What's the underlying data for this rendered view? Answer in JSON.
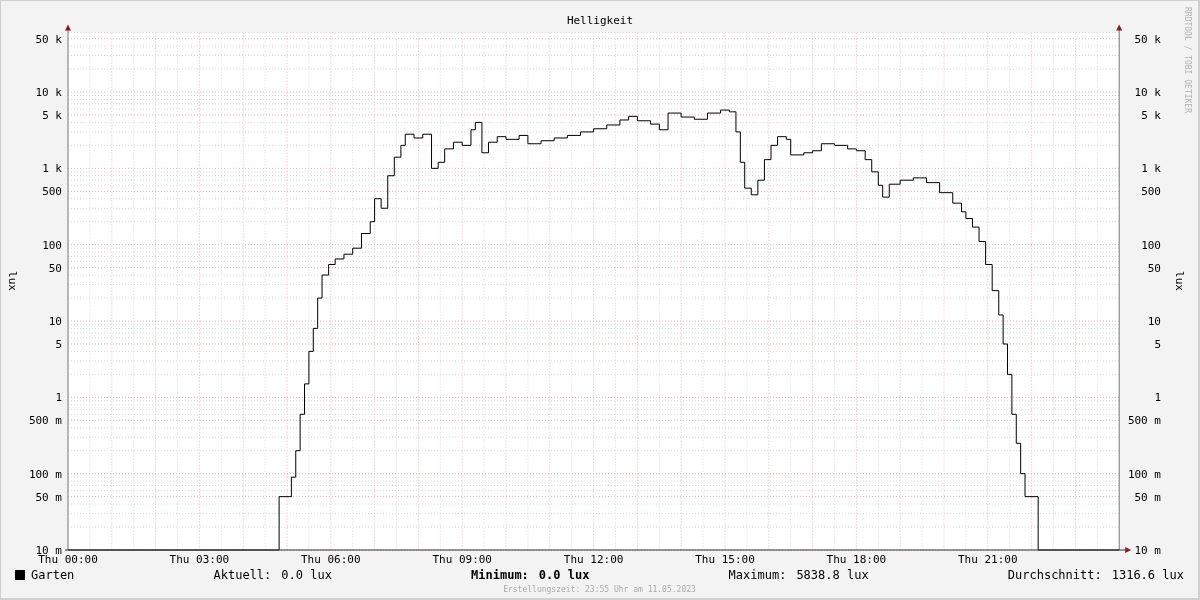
{
  "chart": {
    "title": "Helligkeit",
    "watermark": "RRDTOOL / TOBI OETIKER",
    "left_axis": {
      "label": "lux",
      "tick_labels": [
        "50 k",
        "10 k",
        "5 k",
        "1 k",
        "500",
        "100",
        "50",
        "10",
        "5",
        "1",
        "500 m",
        "100 m",
        "50 m",
        "10 m"
      ]
    },
    "right_axis": {
      "label": "lux",
      "tick_labels": [
        "50 k",
        "10 k",
        "5 k",
        "1 k",
        "500",
        "100",
        "50",
        "10",
        "5",
        "1",
        "500 m",
        "100 m",
        "50 m",
        "10 m"
      ]
    },
    "x_tick_labels": [
      "Thu 00:00",
      "Thu 03:00",
      "Thu 06:00",
      "Thu 09:00",
      "Thu 12:00",
      "Thu 15:00",
      "Thu 18:00",
      "Thu 21:00"
    ]
  },
  "legend": {
    "series_name": "Garten",
    "stats": [
      {
        "label": "Aktuell:",
        "value": "0.0 lux",
        "bold": false
      },
      {
        "label": "Minimum:",
        "value": "0.0 lux",
        "bold": true
      },
      {
        "label": "Maximum:",
        "value": "5838.8 lux",
        "bold": false
      },
      {
        "label": "Durchschnitt:",
        "value": "1316.6 lux",
        "bold": false
      }
    ]
  },
  "footer": "Erstellungszeit: 23:55 Uhr am 11.05.2023"
}
